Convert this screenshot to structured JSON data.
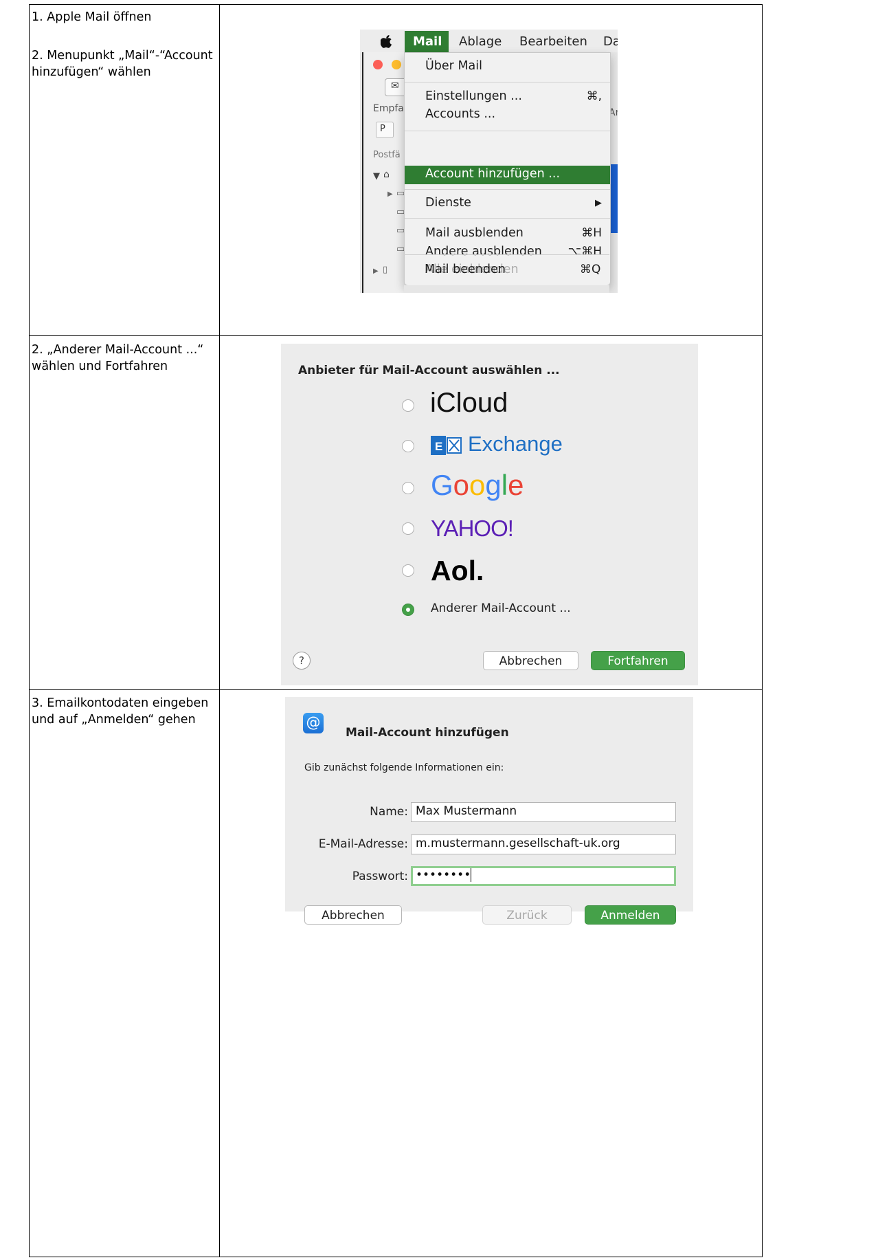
{
  "steps": {
    "s1_line1": "1. Apple Mail öffnen",
    "s1_line2": "2. Menupunkt „Mail“-“Account hinzufügen“ wählen",
    "s2": "2. „Anderer Mail-Account ...“ wählen und Fortfahren",
    "s3": "3. Emailkontodaten eingeben und auf „Anmelden“ gehen"
  },
  "menubar": {
    "app": "Mail",
    "ablage": "Ablage",
    "bearbeiten": "Bearbeiten",
    "darstellung": "Da"
  },
  "mail_window": {
    "empfa": "Empfa",
    "p": "P",
    "postfa": "Postfä",
    "ar": "Ar"
  },
  "mail_menu": {
    "about": "Über Mail",
    "settings": "Einstellungen ...",
    "settings_shortcut": "⌘,",
    "accounts": "Accounts ...",
    "add_account": "Account hinzufügen ...",
    "services": "Dienste",
    "services_arrow": "▶",
    "hide_mail": "Mail ausblenden",
    "hide_mail_shortcut": "⌘H",
    "hide_others": "Andere ausblenden",
    "hide_others_shortcut": "⌥⌘H",
    "show_all": "Alle einblenden",
    "quit": "Mail beenden",
    "quit_shortcut": "⌘Q"
  },
  "provider_dialog": {
    "title": "Anbieter für Mail-Account auswählen ...",
    "icloud": "iCloud",
    "exchange": "Exchange",
    "google": [
      "G",
      "o",
      "o",
      "g",
      "l",
      "e"
    ],
    "yahoo": "YAHOO!",
    "aol": "Aol.",
    "other": "Anderer Mail-Account ...",
    "help": "?",
    "cancel": "Abbrechen",
    "continue": "Fortfahren",
    "selected": "other"
  },
  "account_dialog": {
    "icon": "@",
    "title": "Mail-Account hinzufügen",
    "subtitle": "Gib zunächst folgende Informationen ein:",
    "name_label": "Name:",
    "name_value": "Max Mustermann",
    "email_label": "E-Mail-Adresse:",
    "email_value": "m.mustermann.gesellschaft-uk.org",
    "password_label": "Passwort:",
    "password_value": "••••••••",
    "cancel": "Abbrechen",
    "back": "Zurück",
    "login": "Anmelden"
  },
  "colors": {
    "accent_green": "#45a149",
    "menu_highlight": "#2f7d32",
    "exchange_blue": "#1e6fc4",
    "yahoo_purple": "#5b1fb5"
  }
}
